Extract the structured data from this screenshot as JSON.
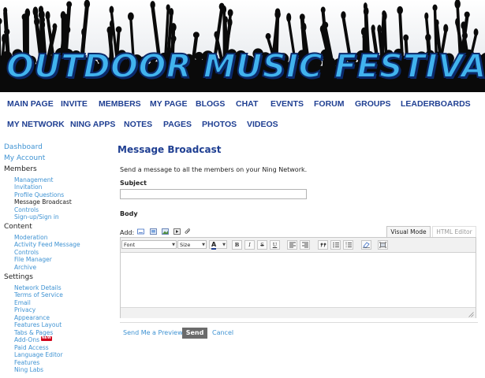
{
  "banner": {
    "title": "OUTDOOR MUSIC FESTIVALS"
  },
  "nav": {
    "row1": [
      "MAIN PAGE",
      "INVITE",
      "MEMBERS",
      "MY PAGE",
      "BLOGS",
      "CHAT",
      "EVENTS",
      "FORUM",
      "GROUPS",
      "LEADERBOARDS"
    ],
    "row2": [
      "MY NETWORK",
      "NING APPS",
      "NOTES",
      "PAGES",
      "PHOTOS",
      "VIDEOS"
    ]
  },
  "sidebar": {
    "dashboard": "Dashboard",
    "my_account": "My Account",
    "members_head": "Members",
    "members_items": [
      "Management",
      "Invitation",
      "Profile Questions",
      "Message Broadcast",
      "Controls",
      "Sign-up/Sign in"
    ],
    "content_head": "Content",
    "content_items": [
      "Moderation",
      "Activity Feed Message",
      "Controls",
      "File Manager",
      "Archive"
    ],
    "settings_head": "Settings",
    "settings_items": [
      "Network Details",
      "Terms of Service",
      "Email",
      "Privacy",
      "Appearance",
      "Features Layout",
      "Tabs & Pages",
      "Add-Ons",
      "Paid Access",
      "Language Editor",
      "Features",
      "Ning Labs"
    ],
    "new_badge": "NEW"
  },
  "main": {
    "title": "Message Broadcast",
    "intro": "Send a message to all the members on your Ning Network.",
    "subject_label": "Subject",
    "subject_value": "",
    "body_label": "Body",
    "add_label": "Add:",
    "visual_tab": "Visual Mode",
    "html_tab": "HTML Editor",
    "toolbar": {
      "font_label": "Font",
      "size_label": "Size",
      "color_glyph": "A",
      "bold": "B",
      "italic": "I",
      "strike": "S",
      "underline": "U"
    },
    "preview_link": "Send Me a Preview",
    "send_button": "Send",
    "cancel_link": "Cancel"
  },
  "colors": {
    "nav_text": "#1f3f92",
    "link": "#3f93d3",
    "title_fill": "#41b3ee",
    "title_outline": "#0b2a6b",
    "send_button_bg": "#6b6b6b"
  }
}
